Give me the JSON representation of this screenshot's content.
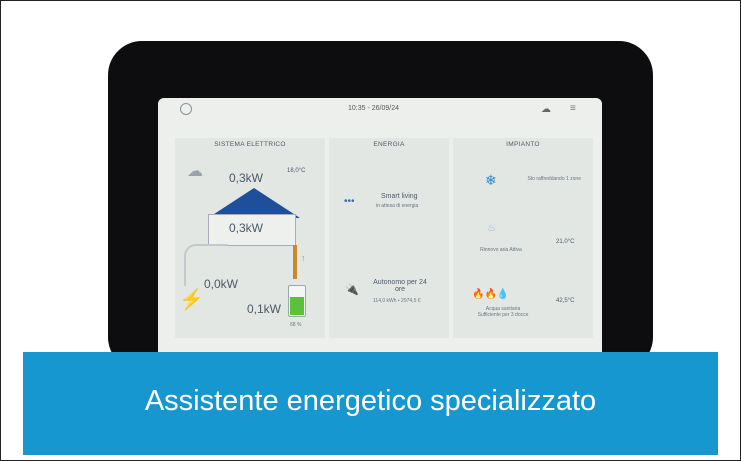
{
  "screen": {
    "time": "10:35 - 26/09/24",
    "columns": [
      "SISTEMA ELETTRICO",
      "ENERGIA",
      "IMPIANTO"
    ]
  },
  "sistema": {
    "temp": "18,0°C",
    "solar_kw": "0,3kW",
    "house_kw": "0,3kW",
    "grid_kw": "0,0kW",
    "battery_kw": "0,1kW",
    "battery_pct": "68 %"
  },
  "energia": {
    "item1_title": "Smart living",
    "item1_sub": "in attesa di energia",
    "item2_title": "Autonomo per 24 ore",
    "item2_sub": "114,0 kWh • 2974,5 €"
  },
  "impianto": {
    "cooling": "Sto raffreddando 1 zone",
    "air_label": "Rinnovo aria Attiva",
    "air_temp": "21,0°C",
    "water_label": "Acqua sanitaria Sufficiente per 3 docce",
    "water_temp": "42,5°C"
  },
  "caption": "Assistente energetico specializzato",
  "colors": {
    "caption_bg": "#1797cf",
    "roof": "#1f4f9a",
    "battery": "#59c23a",
    "flow": "#c98a2c"
  }
}
